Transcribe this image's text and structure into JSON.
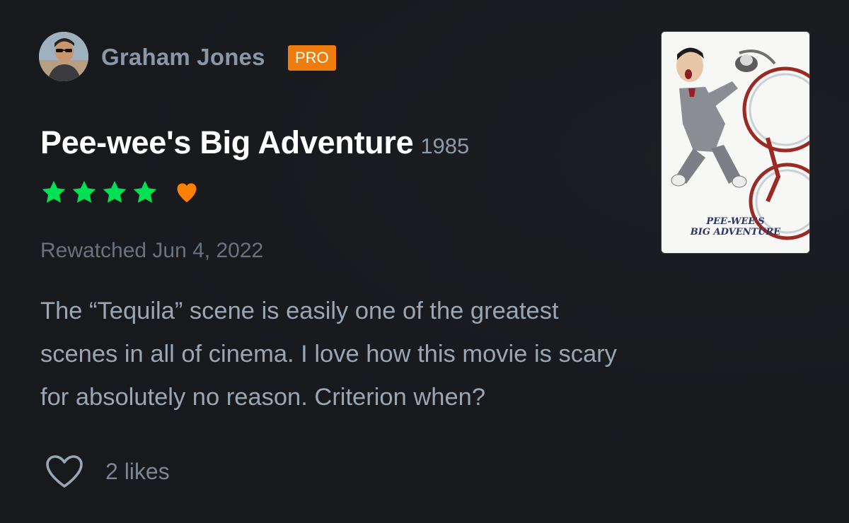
{
  "reviewer": {
    "name": "Graham Jones",
    "badge": "PRO"
  },
  "film": {
    "title": "Pee-wee's Big Adventure",
    "year": "1985",
    "poster_caption_line1": "PEE-WEE'S",
    "poster_caption_line2": "BIG ADVENTURE"
  },
  "rating": {
    "stars": 4,
    "max_stars": 5,
    "liked": true
  },
  "watch_status": "Rewatched Jun 4, 2022",
  "review": {
    "lines": [
      "The “Tequila” scene is easily one of the greatest",
      "scenes in all of cinema. I love how this movie is scary",
      "for absolutely no reason. Criterion when?"
    ]
  },
  "likes": {
    "count_label": "2 likes"
  },
  "colors": {
    "background": "#17191d",
    "star_green": "#00e054",
    "heart_orange": "#ff8000",
    "pro_badge": "#ef7d0d"
  }
}
